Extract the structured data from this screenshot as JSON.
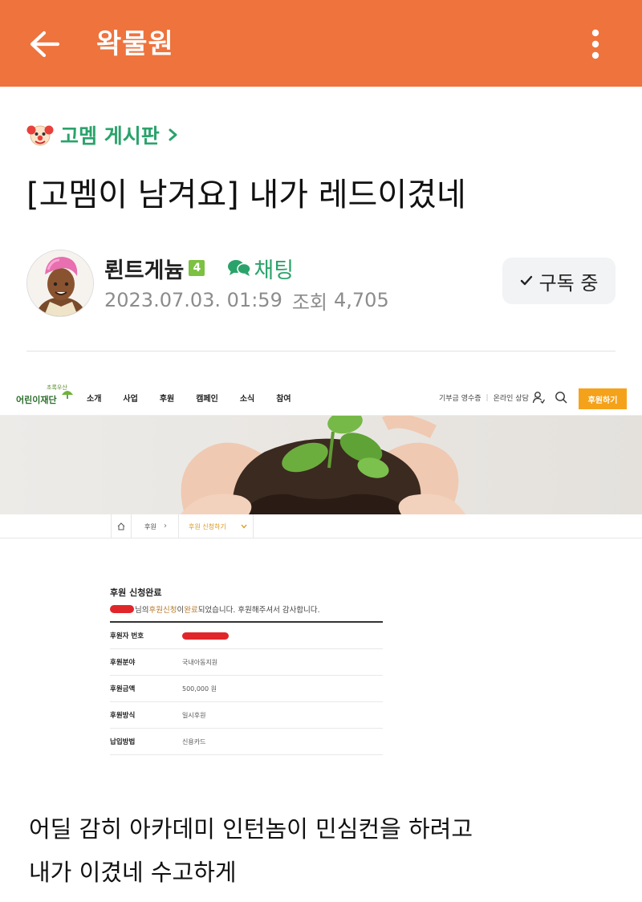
{
  "appbar": {
    "title": "왁물원",
    "color": "#ee733d",
    "back_icon": "arrow-left-icon",
    "more_icon": "kebab-menu-icon"
  },
  "board": {
    "name": "고멤 게시판",
    "icon": "clown-face-icon",
    "chevron": ">",
    "accent": "#2aa36b"
  },
  "post": {
    "title": "[고멤이 남겨요] 내가 레드이겼네",
    "author": "뢴트게늄",
    "level": "4",
    "chat_label": "채팅",
    "date": "2023.07.03. 01:59",
    "views_label": "조회",
    "views": "4,705",
    "subscribe_label": "구독 중",
    "body": [
      "어딜 감히 아카데미 인턴놈이 민심컨을 하려고",
      "내가 이겼네 수고하게"
    ]
  },
  "embedded": {
    "logo_small": "초록우산",
    "logo_main": "어린이재단",
    "menu": [
      "소개",
      "사업",
      "후원",
      "캠페인",
      "소식",
      "참여"
    ],
    "util_links": [
      "기부금 영수증",
      "온라인 상담"
    ],
    "donate_button": "후원하기",
    "breadcrumb": [
      "후원",
      "후원 신청하기"
    ],
    "complete_title": "후원 신청완료",
    "message": {
      "suffix_1": "님의 ",
      "accent_1": "후원신청",
      "mid": "이 ",
      "accent_2": "완료",
      "rest": "되었습니다. 후원해주셔서 감사합니다."
    },
    "rows": [
      {
        "label": "후원자 번호",
        "value": ""
      },
      {
        "label": "후원분야",
        "value": "국내아동지원"
      },
      {
        "label": "후원금액",
        "value": "500,000 원"
      },
      {
        "label": "후원방식",
        "value": "일시후원"
      },
      {
        "label": "납입방법",
        "value": "신용카드"
      }
    ]
  }
}
